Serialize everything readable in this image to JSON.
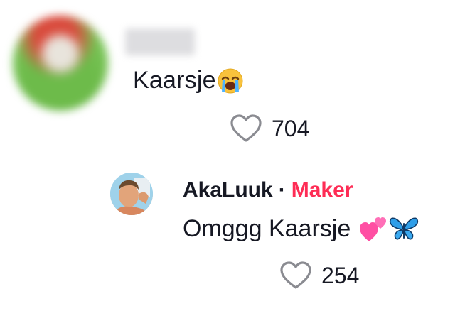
{
  "comment": {
    "text": "Kaarsje",
    "emoji": "loudly-crying-face",
    "likes": "704"
  },
  "reply": {
    "author": "AkaLuuk",
    "separator": "·",
    "badge": "Maker",
    "text": "Omggg Kaarsje",
    "emojis": [
      "two-hearts",
      "butterfly"
    ],
    "likes": "254"
  },
  "colors": {
    "badge": "#fe2c55",
    "text": "#161823",
    "icon": "#8a8b91"
  }
}
